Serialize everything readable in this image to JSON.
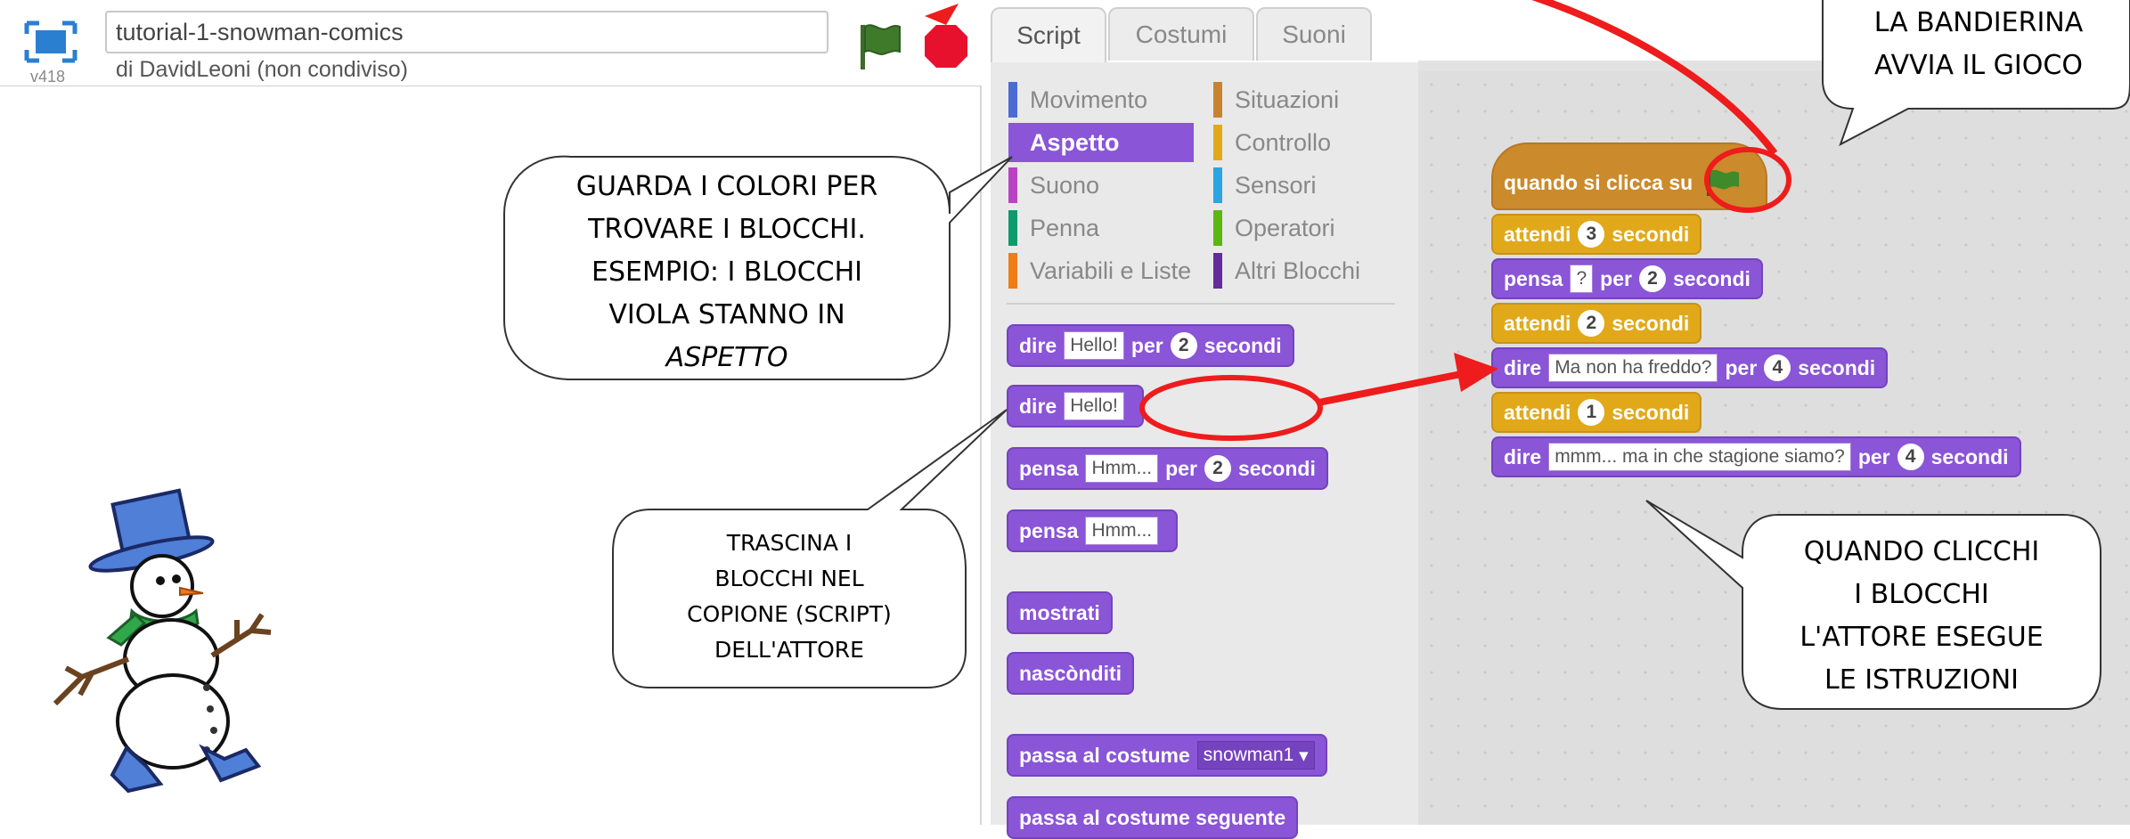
{
  "header": {
    "project_title": "tutorial-1-snowman-comics",
    "owner": "di DavidLeoni (non condiviso)",
    "version": "v418"
  },
  "tabs": [
    {
      "label": "Script"
    },
    {
      "label": "Costumi"
    },
    {
      "label": "Suoni"
    }
  ],
  "categories": [
    {
      "label": "Movimento",
      "color": "#4a6cd4"
    },
    {
      "label": "Situazioni",
      "color": "#c88330"
    },
    {
      "label": "Aspetto",
      "color": "#8a55d7"
    },
    {
      "label": "Controllo",
      "color": "#e1a91a"
    },
    {
      "label": "Suono",
      "color": "#bb42c3"
    },
    {
      "label": "Sensori",
      "color": "#2ca5e2"
    },
    {
      "label": "Penna",
      "color": "#0e9a6c"
    },
    {
      "label": "Operatori",
      "color": "#5cb712"
    },
    {
      "label": "Variabili e Liste",
      "color": "#ee7d16"
    },
    {
      "label": "Altri Blocchi",
      "color": "#632d99"
    }
  ],
  "palette_blocks": {
    "say_for": {
      "word1": "dire",
      "text": "Hello!",
      "word2": "per",
      "num": "2",
      "word3": "secondi"
    },
    "say": {
      "word1": "dire",
      "text": "Hello!"
    },
    "think_for": {
      "word1": "pensa",
      "text": "Hmm...",
      "word2": "per",
      "num": "2",
      "word3": "secondi"
    },
    "think": {
      "word1": "pensa",
      "text": "Hmm..."
    },
    "show": "mostrati",
    "hide": "nascònditi",
    "switch_costume": {
      "word1": "passa al costume",
      "value": "snowman1"
    },
    "next_costume": "passa al costume seguente"
  },
  "script": {
    "hat": "quando si clicca su",
    "wait1": {
      "word1": "attendi",
      "num": "3",
      "word2": "secondi"
    },
    "think": {
      "word1": "pensa",
      "text": "?",
      "word2": "per",
      "num": "2",
      "word3": "secondi"
    },
    "wait2": {
      "word1": "attendi",
      "num": "2",
      "word2": "secondi"
    },
    "say1": {
      "word1": "dire",
      "text": "Ma non ha freddo?",
      "word2": "per",
      "num": "4",
      "word3": "secondi"
    },
    "wait3": {
      "word1": "attendi",
      "num": "1",
      "word2": "secondi"
    },
    "say2": {
      "word1": "dire",
      "text": "mmm... ma in che stagione siamo?",
      "word2": "per",
      "num": "4",
      "word3": "secondi"
    }
  },
  "callouts": {
    "flag": [
      "LA BANDIERINA",
      "AVVIA IL GIOCO"
    ],
    "colors": [
      "GUARDA I COLORI PER",
      "TROVARE I BLOCCHI.",
      "ESEMPIO: I BLOCCHI",
      "VIOLA STANNO IN",
      "ASPETTO"
    ],
    "drag": [
      "TRASCINA I",
      "BLOCCHI NEL",
      "COPIONE (SCRIPT)",
      "DELL'ATTORE"
    ],
    "click": [
      "QUANDO CLICCHI",
      "I BLOCCHI",
      "L'ATTORE ESEGUE",
      "LE ISTRUZIONI"
    ]
  },
  "icons": {
    "fullscreen": "fullscreen-icon",
    "flag": "green-flag-icon",
    "stop": "stop-sign-icon"
  },
  "colors": {
    "looks": "#8a55d7",
    "control": "#e1a91a",
    "events": "#cb8a2b",
    "annotation": "#ee1c1c"
  }
}
